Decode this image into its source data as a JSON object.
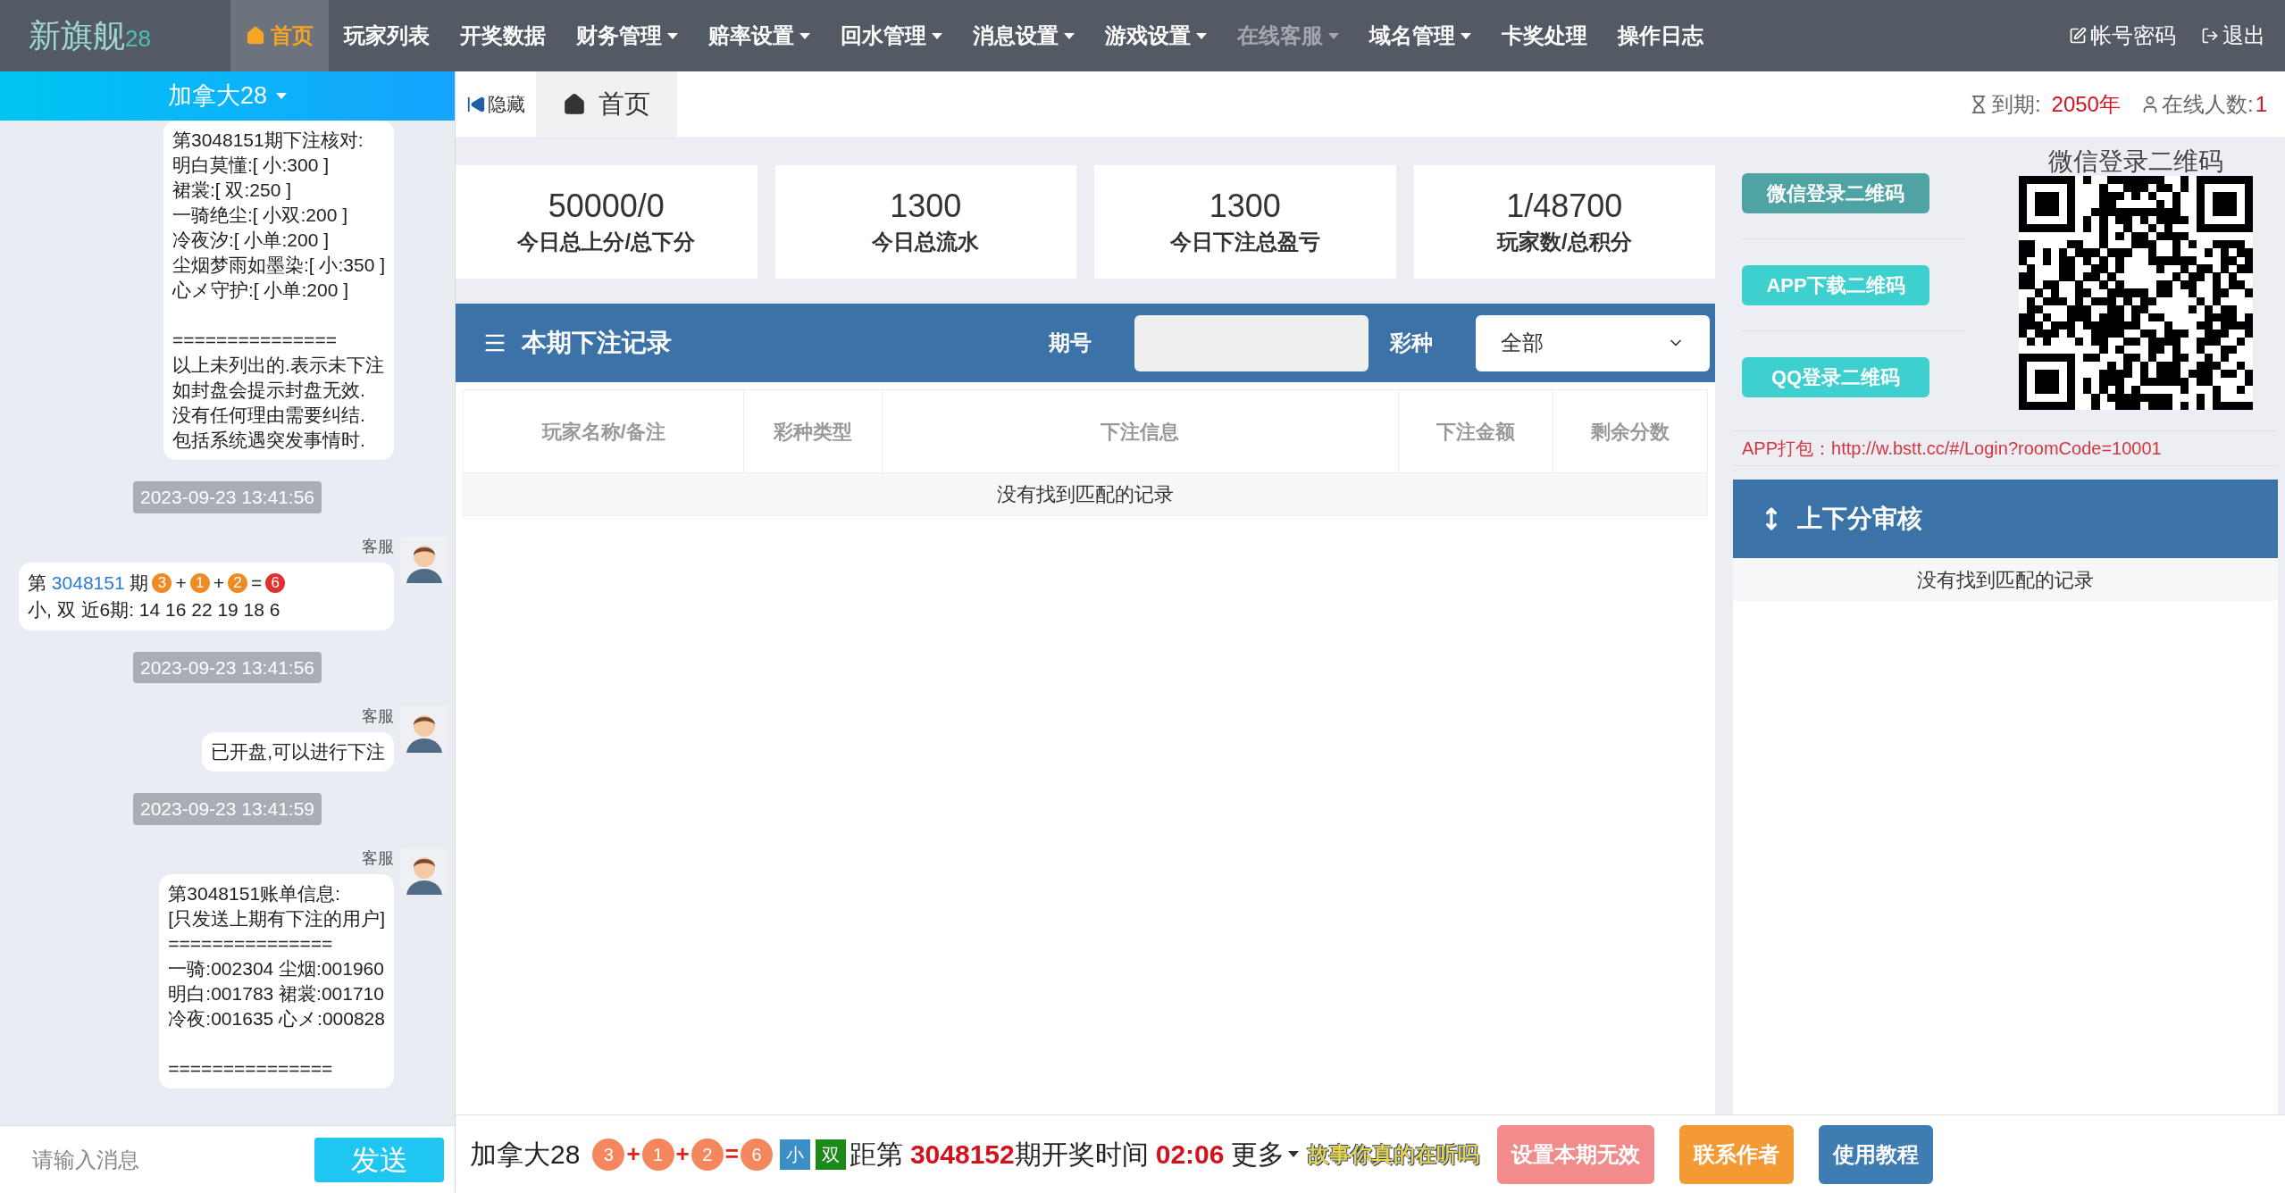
{
  "nav": {
    "logo": "新旗舰",
    "logo_suffix": "28",
    "items": [
      {
        "label": "首页",
        "selected": true,
        "dropdown": false,
        "disabled": false
      },
      {
        "label": "玩家列表",
        "selected": false,
        "dropdown": false,
        "disabled": false
      },
      {
        "label": "开奖数据",
        "selected": false,
        "dropdown": false,
        "disabled": false
      },
      {
        "label": "财务管理",
        "selected": false,
        "dropdown": true,
        "disabled": false
      },
      {
        "label": "赔率设置",
        "selected": false,
        "dropdown": true,
        "disabled": false
      },
      {
        "label": "回水管理",
        "selected": false,
        "dropdown": true,
        "disabled": false
      },
      {
        "label": "消息设置",
        "selected": false,
        "dropdown": true,
        "disabled": false
      },
      {
        "label": "游戏设置",
        "selected": false,
        "dropdown": true,
        "disabled": false
      },
      {
        "label": "在线客服",
        "selected": false,
        "dropdown": true,
        "disabled": true
      },
      {
        "label": "域名管理",
        "selected": false,
        "dropdown": true,
        "disabled": false
      },
      {
        "label": "卡奖处理",
        "selected": false,
        "dropdown": false,
        "disabled": false
      },
      {
        "label": "操作日志",
        "selected": false,
        "dropdown": false,
        "disabled": false
      }
    ],
    "account": "帐号密码",
    "logout": "退出"
  },
  "chat": {
    "room": "加拿大28",
    "messages": [
      {
        "kind": "bubble",
        "blocks": [
          [
            "第3048151期下注核对:",
            "明白莫懂:[ 小:300 ]",
            "裙裳:[ 双:250 ]",
            "一骑绝尘:[ 小双:200 ]",
            "冷夜汐:[ 小单:200 ]",
            "尘烟梦雨如墨染:[ 小:350 ]",
            "心メ守护:[ 小单:200 ]"
          ],
          [
            "===============",
            "以上未列出的.表示未下注",
            "如封盘会提示封盘无效.",
            "没有任何理由需要纠结.",
            "包括系统遇突发事情时."
          ]
        ]
      },
      {
        "kind": "time",
        "text": "2023-09-23 13:41:56"
      },
      {
        "kind": "result",
        "sender": "客服",
        "parts": [
          {
            "kind": "text",
            "text": "第 "
          },
          {
            "kind": "link",
            "text": "3048151"
          },
          {
            "kind": "text",
            "text": " 期"
          },
          {
            "kind": "ball",
            "text": "3",
            "color": "#f08a24"
          },
          {
            "kind": "text",
            "text": "+"
          },
          {
            "kind": "ball",
            "text": "1",
            "color": "#f08a24"
          },
          {
            "kind": "text",
            "text": "+"
          },
          {
            "kind": "ball",
            "text": "2",
            "color": "#f08a24"
          },
          {
            "kind": "text",
            "text": "="
          },
          {
            "kind": "ball",
            "text": "6",
            "color": "#e03030"
          },
          {
            "kind": "text",
            "text": "小, 双 近6期: 14 16 22 19 18 6"
          }
        ]
      },
      {
        "kind": "time",
        "text": "2023-09-23 13:41:56"
      },
      {
        "kind": "bubble",
        "sender": "客服",
        "blocks": [
          [
            "已开盘,可以进行下注"
          ]
        ]
      },
      {
        "kind": "time",
        "text": "2023-09-23 13:41:59"
      },
      {
        "kind": "bubble",
        "sender": "客服",
        "blocks": [
          [
            "第3048151账单信息:",
            "[只发送上期有下注的用户]",
            "===============",
            "一骑:002304 尘烟:001960",
            "明白:001783 裙裳:001710",
            "冷夜:001635 心メ:000828"
          ],
          [
            "==============="
          ]
        ]
      }
    ],
    "input": {
      "placeholder": "请输入消息"
    },
    "send": "发送"
  },
  "tabbar": {
    "hide": "隐藏",
    "tabs": [
      {
        "label": "首页",
        "selected": true
      }
    ],
    "expiry_label": "到期:",
    "expiry": "2050年",
    "online_label": "在线人数:",
    "online": "1"
  },
  "stats": [
    {
      "value": "50000/0",
      "label": "今日总上分/总下分"
    },
    {
      "value": "1300",
      "label": "今日总流水"
    },
    {
      "value": "1300",
      "label": "今日下注总盈亏"
    },
    {
      "value": "1/48700",
      "label": "玩家数/总积分"
    }
  ],
  "bets": {
    "title": "本期下注记录",
    "issue_label": "期号",
    "type_label": "彩种",
    "type_value": "全部",
    "columns": [
      "玩家名称/备注",
      "彩种类型",
      "下注信息",
      "下注金额",
      "剩余分数"
    ],
    "empty": "没有找到匹配的记录"
  },
  "qr": {
    "buttons": [
      {
        "label": "微信登录二维码",
        "selected": true
      },
      {
        "label": "APP下载二维码",
        "selected": false
      },
      {
        "label": "QQ登录二维码",
        "selected": false
      }
    ],
    "title": "微信登录二维码",
    "app_pack_label": "APP打包：",
    "app_pack_url": "http://w.bstt.cc/#/Login?roomCode=10001"
  },
  "review": {
    "title": "上下分审核",
    "empty": "没有找到匹配的记录"
  },
  "bottom": {
    "game": "加拿大28",
    "result": [
      {
        "kind": "ball",
        "text": "3"
      },
      {
        "kind": "op",
        "text": "+"
      },
      {
        "kind": "ball",
        "text": "1"
      },
      {
        "kind": "op",
        "text": "+"
      },
      {
        "kind": "ball",
        "text": "2"
      },
      {
        "kind": "op",
        "text": "="
      },
      {
        "kind": "ball",
        "text": "6"
      },
      {
        "kind": "tag",
        "text": "小",
        "color": "#3a8fc6"
      },
      {
        "kind": "tag",
        "text": "双",
        "color": "#1b8a1b"
      }
    ],
    "countdown_prefix": "距第",
    "next_issue": "3048152",
    "countdown_suffix": "期开奖时间",
    "timer": "02:06",
    "more": "更多",
    "marquee": "故事你真的在听吗",
    "buttons": [
      {
        "label": "设置本期无效",
        "color": "#f28b8b"
      },
      {
        "label": "联系作者",
        "color": "#f39a35"
      },
      {
        "label": "使用教程",
        "color": "#3e7cb1"
      }
    ]
  }
}
